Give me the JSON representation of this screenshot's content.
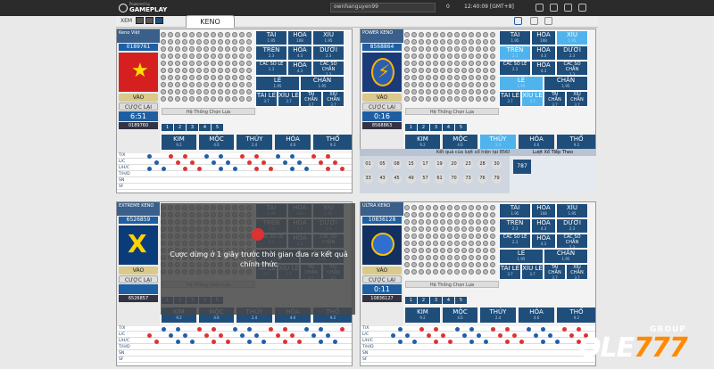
{
  "topbar": {
    "brand_small": "Powered by",
    "brand": "GAMEPLAY",
    "username": "ownhanguyen99",
    "balance": "0",
    "time": "12:40:09 [GMT+8]"
  },
  "subbar": {
    "xem": "XEM",
    "tab": "KENO"
  },
  "panels": [
    {
      "name": "Keno Việt",
      "draw_no": "0189761",
      "flag": "vietnam",
      "vao": "VÀO",
      "cuoc_lai": "CƯỢC LẠI",
      "timer": "6:51",
      "prev": "0189760",
      "chip_title": "Hệ Thống Chọn Lựa",
      "chips": [
        "1",
        "2",
        "3",
        "4",
        "5"
      ],
      "bets": [
        {
          "l": "TÀI",
          "o": "1.95"
        },
        {
          "l": "HÒA",
          "o": "108"
        },
        {
          "l": "XỈU",
          "o": "1.95"
        },
        {
          "l": "TRÊN",
          "o": "2.3"
        },
        {
          "l": "HÒA",
          "o": "4.3"
        },
        {
          "l": "DƯỚI",
          "o": "2.3"
        },
        {
          "l": "CÁC SỐ LẺ",
          "o": "2.3"
        },
        {
          "l": "HÒA",
          "o": "4.3"
        },
        {
          "l": "CÁC SỐ CHẴN",
          "o": "2.3"
        },
        {
          "l": "LẺ",
          "o": "1.95"
        },
        {
          "l": "CHẴN",
          "o": "1.95"
        },
        {
          "l": "TÀI LẺ",
          "o": "3.7"
        },
        {
          "l": "XỈU LẺ",
          "o": "3.7"
        },
        {
          "l": "TÀI CHẴN",
          "o": "3.7"
        },
        {
          "l": "XỈU CHẴN",
          "o": "3.7"
        }
      ],
      "elements": [
        {
          "l": "KIM",
          "o": "9.2"
        },
        {
          "l": "MỘC",
          "o": "4.6"
        },
        {
          "l": "THỦY",
          "o": "2.4"
        },
        {
          "l": "HỎA",
          "o": "4.6"
        },
        {
          "l": "THỔ",
          "o": "9.2"
        }
      ]
    },
    {
      "name": "POWER KENO",
      "draw_no": "8568864",
      "flag": "power",
      "vao": "VÀO",
      "cuoc_lai": "CƯỢC LẠI",
      "timer": "0:16",
      "prev": "8568863",
      "chip_title": "Hệ Thống Chọn Lựa",
      "chips": [
        "1",
        "2",
        "3",
        "4",
        "5"
      ],
      "bets": [
        {
          "l": "TÀI",
          "o": "1.95"
        },
        {
          "l": "HÒA",
          "o": "108"
        },
        {
          "l": "XỈU",
          "o": "1.95"
        },
        {
          "l": "TRÊN",
          "o": "2.3"
        },
        {
          "l": "HÒA",
          "o": "4.3"
        },
        {
          "l": "DƯỚI",
          "o": "2.3"
        },
        {
          "l": "CÁC SỐ LẺ",
          "o": "2.3"
        },
        {
          "l": "HÒA",
          "o": "4.3"
        },
        {
          "l": "CÁC SỐ CHẴN",
          "o": "2.3"
        },
        {
          "l": "LẺ",
          "o": "1.95"
        },
        {
          "l": "CHẴN",
          "o": "1.95"
        },
        {
          "l": "TÀI LẺ",
          "o": "3.7"
        },
        {
          "l": "XỈU LẺ",
          "o": "3.7"
        },
        {
          "l": "TÀI CHẴN",
          "o": "3.7"
        },
        {
          "l": "XỈU CHẴN",
          "o": "3.7"
        }
      ],
      "elements": [
        {
          "l": "KIM",
          "o": "9.2"
        },
        {
          "l": "MỘC",
          "o": "4.6"
        },
        {
          "l": "THỦY",
          "o": "2.4"
        },
        {
          "l": "HỎA",
          "o": "4.6"
        },
        {
          "l": "THỔ",
          "o": "9.2"
        }
      ]
    },
    {
      "name": "EXTREME KENO",
      "draw_no": "6526859",
      "flag": "extreme",
      "vao": "VÀO",
      "cuoc_lai": "CƯỢC LẠI",
      "timer": "",
      "prev": "6526857",
      "chip_title": "Hệ Thống Chọn Lựa",
      "chips": [
        "1",
        "2",
        "3",
        "4",
        "5"
      ],
      "bets": [
        {
          "l": "TÀI",
          "o": "1.95"
        },
        {
          "l": "HÒA",
          "o": "108"
        },
        {
          "l": "XỈU",
          "o": "1.95"
        },
        {
          "l": "TRÊN",
          "o": "2.3"
        },
        {
          "l": "HÒA",
          "o": "4.3"
        },
        {
          "l": "DƯỚI",
          "o": "2.3"
        },
        {
          "l": "CÁC SỐ LẺ",
          "o": "2.3"
        },
        {
          "l": "HÒA",
          "o": "4.3"
        },
        {
          "l": "CÁC SỐ CHẴN",
          "o": "2.3"
        },
        {
          "l": "LẺ",
          "o": "1.95"
        },
        {
          "l": "CHẴN",
          "o": "1.95"
        },
        {
          "l": "TÀI LẺ",
          "o": "3.7"
        },
        {
          "l": "XỈU LẺ",
          "o": "3.7"
        },
        {
          "l": "TÀI CHẴN",
          "o": "3.7"
        },
        {
          "l": "XỈU CHẴN",
          "o": "3.7"
        }
      ],
      "elements": [
        {
          "l": "KIM",
          "o": "9.2"
        },
        {
          "l": "MỘC",
          "o": "4.6"
        },
        {
          "l": "THỦY",
          "o": "2.4"
        },
        {
          "l": "HỎA",
          "o": "4.6"
        },
        {
          "l": "THỔ",
          "o": "9.2"
        }
      ]
    },
    {
      "name": "ULTRA KENO",
      "draw_no": "10836128",
      "flag": "ultra",
      "vao": "VÀO",
      "cuoc_lai": "CƯỢC LẠI",
      "timer": "0:11",
      "prev": "10836127",
      "chip_title": "Hệ Thống Chọn Lựa",
      "chips": [
        "1",
        "2",
        "3",
        "4",
        "5"
      ],
      "bets": [
        {
          "l": "TÀI",
          "o": "1.95"
        },
        {
          "l": "HÒA",
          "o": "108"
        },
        {
          "l": "XỈU",
          "o": "1.95"
        },
        {
          "l": "TRÊN",
          "o": "2.3"
        },
        {
          "l": "HÒA",
          "o": "4.3"
        },
        {
          "l": "DƯỚI",
          "o": "2.3"
        },
        {
          "l": "CÁC SỐ LẺ",
          "o": "2.3"
        },
        {
          "l": "HÒA",
          "o": "4.3"
        },
        {
          "l": "CÁC SỐ CHẴN",
          "o": "2.3"
        },
        {
          "l": "LẺ",
          "o": "1.95"
        },
        {
          "l": "CHẴN",
          "o": "1.95"
        },
        {
          "l": "TÀI LẺ",
          "o": "3.7"
        },
        {
          "l": "XỈU LẺ",
          "o": "3.7"
        },
        {
          "l": "TÀI CHẴN",
          "o": "3.7"
        },
        {
          "l": "XỈU CHẴN",
          "o": "3.7"
        }
      ],
      "elements": [
        {
          "l": "KIM",
          "o": "9.2"
        },
        {
          "l": "MỘC",
          "o": "4.6"
        },
        {
          "l": "THỦY",
          "o": "2.4"
        },
        {
          "l": "HỎA",
          "o": "4.6"
        },
        {
          "l": "THỔ",
          "o": "9.2"
        }
      ]
    }
  ],
  "history_labels": [
    "T/X",
    "L/C",
    "L/H/C",
    "T/H/D",
    "SN",
    "SF"
  ],
  "overlay_message": "Cược dừng ở 1 giây trước thời gian đưa ra kết quả chính thức",
  "result": {
    "title": "Kết quả của lượt xổ hiện tại",
    "draw": "8568863",
    "side_title": "Lượt Xổ Tiếp Theo",
    "side_value": "787",
    "balls": [
      "01",
      "05",
      "08",
      "15",
      "17",
      "19",
      "20",
      "23",
      "28",
      "30",
      "33",
      "43",
      "45",
      "49",
      "57",
      "61",
      "70",
      "73",
      "76",
      "79"
    ]
  },
  "brand_logo": {
    "group": "GROUP",
    "ole": "OLE",
    "n": "777"
  },
  "colors": {
    "bet_bg": "#1f4e7a",
    "bet_highlight": "#4fb4ee",
    "red_dot": "#e03131",
    "blue_dot": "#1f5fa8"
  }
}
